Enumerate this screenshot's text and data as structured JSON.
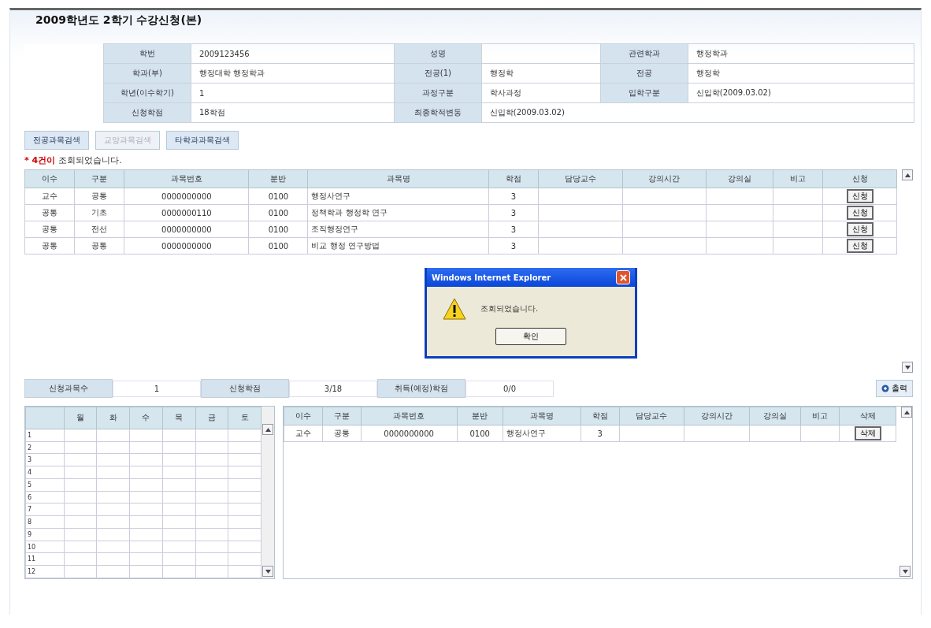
{
  "title": "2009학년도 2학기 수강신청(본)",
  "info": {
    "rows": [
      [
        {
          "label": "학번",
          "value": "2009123456"
        },
        {
          "label": "성명"
        },
        {
          "label": "관련학과",
          "value": "행정학과"
        }
      ],
      [
        {
          "label": "학과(부)",
          "value": "행정대학 행정학과"
        },
        {
          "label": "전공(1)",
          "value": "행정학"
        },
        {
          "label": "전공",
          "value": "행정학"
        }
      ],
      [
        {
          "label": "학년(이수학기)",
          "value": "1"
        },
        {
          "label": "과정구분",
          "value": "학사과정"
        },
        {
          "label": "입학구분",
          "value": "신입학(2009.03.02)"
        }
      ],
      [
        {
          "label": "신청학점",
          "value": "18학점"
        },
        {
          "label": "최종학적변동",
          "value": "신입학(2009.03.02)"
        }
      ]
    ]
  },
  "buttons": [
    {
      "label": "전공과목검색",
      "disabled": false
    },
    {
      "label": "교양과목검색",
      "disabled": true
    },
    {
      "label": "타학과과목검색",
      "disabled": false
    }
  ],
  "notice": {
    "count": "* 4건이",
    "text": "조회되었습니다."
  },
  "courses": {
    "columns": [
      "이수",
      "구분",
      "과목번호",
      "분반",
      "과목명",
      "학점",
      "담당교수",
      "강의시간",
      "강의실",
      "비고",
      "신청"
    ],
    "rows": [
      {
        "cells": [
          "교수",
          "공통",
          "0000000000",
          "0100",
          "행정사연구",
          "3",
          "",
          "",
          "",
          "",
          ""
        ],
        "action": "신청"
      },
      {
        "cells": [
          "공통",
          "기초",
          "0000000110",
          "0100",
          "정책학과 행정학 연구",
          "3",
          "",
          "",
          "",
          "",
          ""
        ],
        "action": "신청"
      },
      {
        "cells": [
          "공통",
          "전선",
          "0000000000",
          "0100",
          "조직행정연구",
          "3",
          "",
          "",
          "",
          "",
          ""
        ],
        "action": "신청"
      },
      {
        "cells": [
          "공통",
          "공통",
          "0000000000",
          "0100",
          "비교 행정 연구방법",
          "3",
          "",
          "",
          "",
          "",
          ""
        ],
        "action": "신청"
      }
    ]
  },
  "dialog": {
    "title": "Windows Internet Explorer",
    "message": "조회되었습니다.",
    "button": "확인"
  },
  "summary": [
    {
      "label": "신청과목수",
      "value": "1"
    },
    {
      "label": "신청학점",
      "value": "3/18"
    },
    {
      "label": "취득(예정)학점",
      "value": "0/0"
    }
  ],
  "print_button": "출력",
  "timetable": {
    "days": [
      "월",
      "화",
      "수",
      "목",
      "금",
      "토"
    ],
    "periods": [
      "1",
      "2",
      "3",
      "4",
      "5",
      "6",
      "7",
      "8",
      "9",
      "10",
      "11",
      "12"
    ]
  },
  "applied": {
    "columns": [
      "이수",
      "구분",
      "과목번호",
      "분반",
      "과목명",
      "학점",
      "담당교수",
      "강의시간",
      "강의실",
      "비고",
      "삭제"
    ],
    "rows": [
      {
        "cells": [
          "교수",
          "공통",
          "0000000000",
          "0100",
          "행정사연구",
          "3",
          "",
          "",
          "",
          "",
          ""
        ],
        "action": "삭제"
      }
    ]
  }
}
